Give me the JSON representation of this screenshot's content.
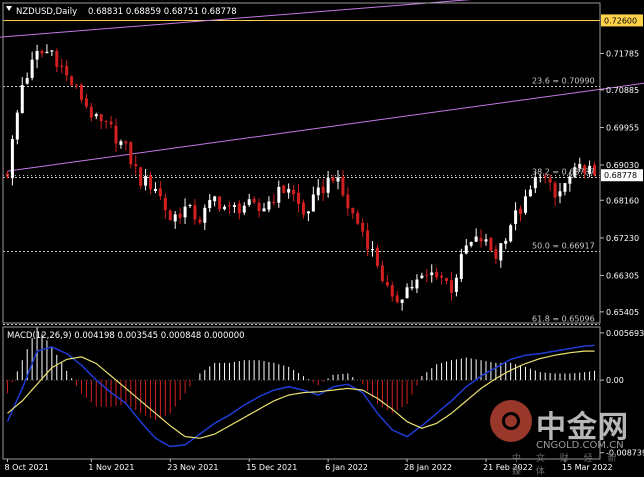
{
  "colors": {
    "background": "#000000",
    "up_candle": "#ffffff",
    "down_candle": "#d21f1f",
    "fib_line": "#c8c8c8",
    "channel_line": "#c57ae6",
    "resistance_line": "#ffd24a",
    "macd_line": "#1f3bd6",
    "signal_line": "#e8e070",
    "hist_pos": "#ffffff",
    "hist_neg": "#d21f1f",
    "text": "#ffffff",
    "axis_text": "#ffffff"
  },
  "header": {
    "symbol_timeframe": "NZDUSD,Daily",
    "ohlc": "0.68831 0.68859 0.68751 0.68778"
  },
  "macd_header": "MACD(12,26,9) 0.004198 0.003545 0.000848 0.000000",
  "price_axis": {
    "ticks": [
      "0.71785",
      "0.70885",
      "0.69955",
      "0.69030",
      "0.68160",
      "0.67230",
      "0.66305",
      "0.65405"
    ],
    "tick_values": [
      0.71785,
      0.70885,
      0.69955,
      0.6903,
      0.6816,
      0.6723,
      0.66305,
      0.65405
    ],
    "highlight_yellow": {
      "label": "0.72600",
      "value": 0.726
    },
    "highlight_current": {
      "label": "0.68778",
      "value": 0.68778
    },
    "range": [
      0.6513,
      0.7303
    ]
  },
  "macd_axis": {
    "ticks": [
      "0.005693",
      "0.00",
      "-0.008739"
    ],
    "tick_values": [
      0.005693,
      0.0,
      -0.008739
    ],
    "range": [
      -0.0095,
      0.0064
    ]
  },
  "time_axis": {
    "labels": [
      "8 Oct 2021",
      "1 Nov 2021",
      "23 Nov 2021",
      "15 Dec 2021",
      "6 Jan 2022",
      "28 Jan 2022",
      "21 Feb 2022",
      "15 Mar 2022"
    ],
    "label_bar_index": [
      0,
      17,
      33,
      49,
      65,
      81,
      97,
      113
    ]
  },
  "fib_levels": [
    {
      "label": "23.6 = 0.70990",
      "value": 0.7099
    },
    {
      "label": "38.2 = 0.68737",
      "value": 0.68737
    },
    {
      "label": "50.0 = 0.66917",
      "value": 0.66917
    },
    {
      "label": "61.8 = 0.65096",
      "value": 0.65096
    }
  ],
  "channel": {
    "upper": {
      "start": [
        -25,
        0.7196
      ],
      "end": [
        150,
        0.7366
      ]
    },
    "lower": {
      "start": [
        0,
        0.6888
      ],
      "end": [
        160,
        0.7157
      ]
    }
  },
  "chart_data": {
    "type": "line",
    "title": "NZDUSD,Daily",
    "x": [
      0,
      3,
      6,
      9,
      12,
      15,
      18,
      21,
      24,
      27,
      30,
      33,
      36,
      39,
      42,
      45,
      48,
      51,
      54,
      57,
      60,
      63,
      66,
      69,
      72,
      75,
      78,
      81,
      84,
      87,
      90,
      93,
      96,
      99,
      102,
      105,
      108,
      111,
      114,
      117,
      119
    ],
    "series": [
      {
        "values": [
          0.6886,
          0.7102,
          0.7175,
          0.7185,
          0.712,
          0.707,
          0.701,
          0.699,
          0.694,
          0.6865,
          0.685,
          0.677,
          0.6795,
          0.677,
          0.682,
          0.679,
          0.6805,
          0.679,
          0.6825,
          0.685,
          0.678,
          0.683,
          0.688,
          0.68,
          0.674,
          0.666,
          0.656,
          0.66,
          0.662,
          0.664,
          0.66,
          0.67,
          0.672,
          0.668,
          0.676,
          0.681,
          0.689,
          0.682,
          0.687,
          0.69,
          0.6878
        ]
      },
      {
        "values": [
          -0.005,
          -0.001,
          0.0035,
          0.004,
          0.0032,
          0.0018,
          0.0,
          -0.0015,
          -0.0028,
          -0.005,
          -0.007,
          -0.008,
          -0.0078,
          -0.0065,
          -0.0052,
          -0.0042,
          -0.003,
          -0.002,
          -0.0012,
          -0.0008,
          -0.0012,
          -0.0018,
          -0.0008,
          -0.0005,
          -0.0015,
          -0.004,
          -0.006,
          -0.0068,
          -0.0055,
          -0.004,
          -0.0025,
          -0.0008,
          0.0005,
          0.0015,
          0.0025,
          0.003,
          0.0032,
          0.0035,
          0.0038,
          0.0041,
          0.0042
        ]
      },
      {
        "values": [
          -0.004,
          -0.0025,
          -0.0005,
          0.0015,
          0.0025,
          0.0028,
          0.002,
          0.0005,
          -0.001,
          -0.0025,
          -0.004,
          -0.0055,
          -0.0068,
          -0.007,
          -0.0065,
          -0.0055,
          -0.0045,
          -0.0035,
          -0.0025,
          -0.0018,
          -0.0015,
          -0.0014,
          -0.0012,
          -0.001,
          -0.0012,
          -0.0022,
          -0.0035,
          -0.005,
          -0.0058,
          -0.0052,
          -0.004,
          -0.0025,
          -0.001,
          0.0002,
          0.0012,
          0.002,
          0.0026,
          0.003,
          0.0033,
          0.0035,
          0.0035
        ]
      }
    ],
    "ylim": [
      0.6513,
      0.7303
    ]
  },
  "watermark": {
    "brand": "中金网",
    "site": "CNGOLD.COM.CN",
    "sub": "中 文 财 经 新 媒 体"
  }
}
